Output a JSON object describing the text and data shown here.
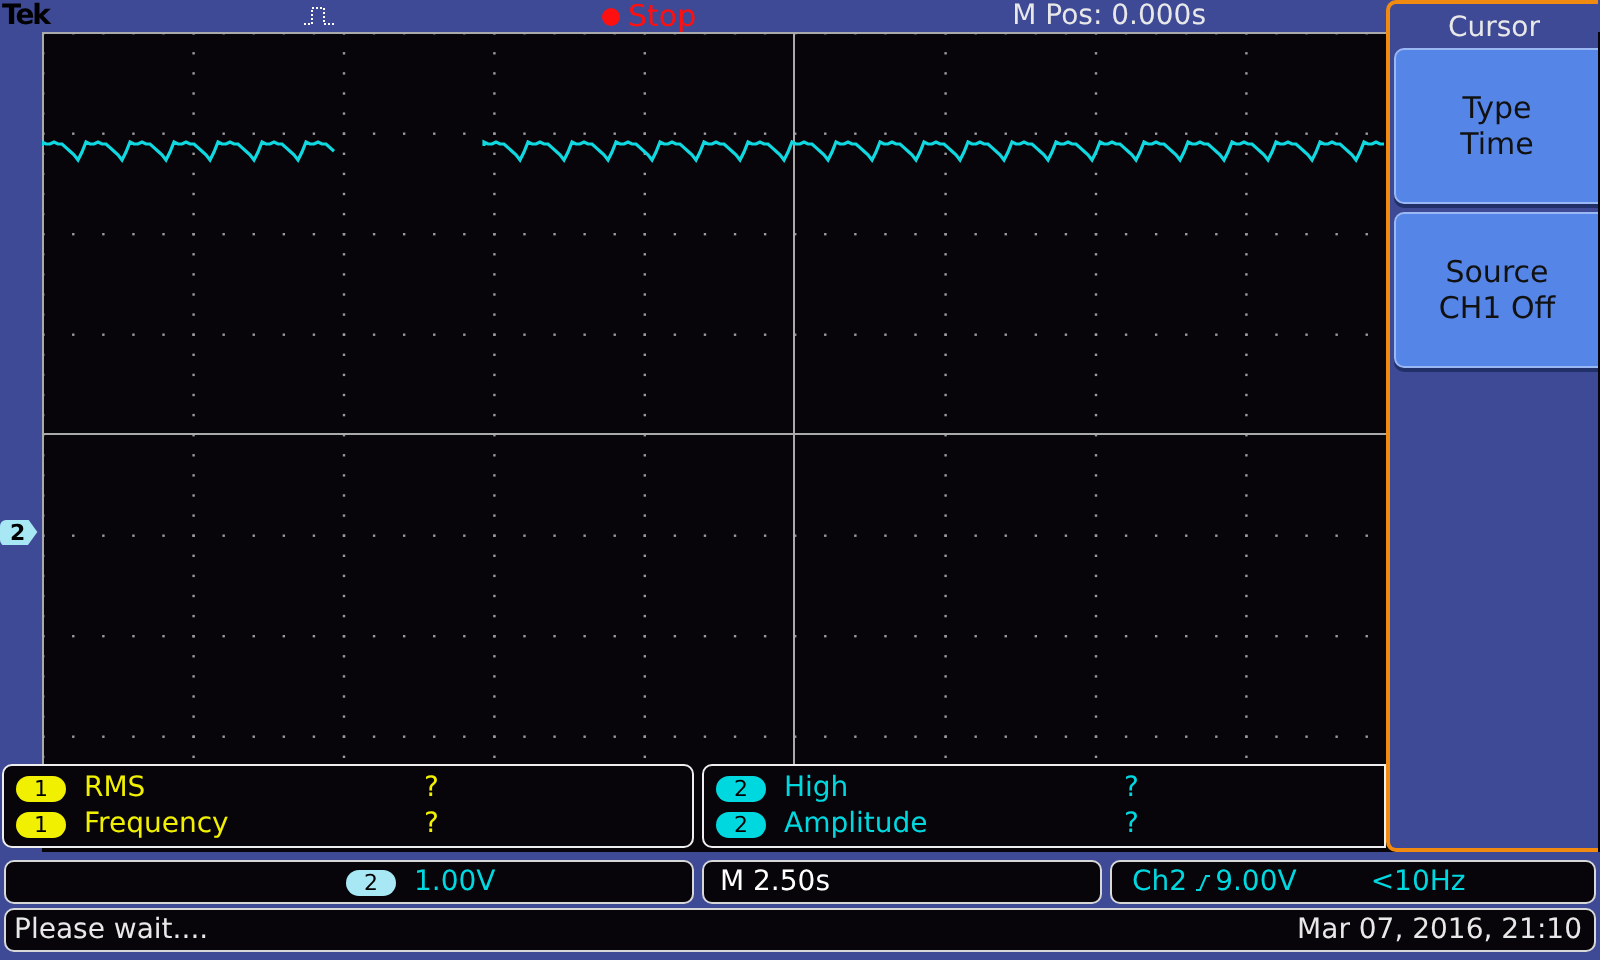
{
  "top_bar": {
    "brand": "Tek",
    "acquisition": {
      "label": "Stop",
      "running": false
    },
    "position": "M Pos: 0.000s"
  },
  "channel_marker": {
    "label": "2",
    "color": "#a8e8f4"
  },
  "side_menu": {
    "title": "Cursor",
    "buttons": [
      {
        "label": "Type",
        "value": "Time"
      },
      {
        "label": "Source",
        "value": "CH1 Off"
      }
    ]
  },
  "measurements": [
    [
      {
        "channel": "1",
        "name": "RMS",
        "value": "?",
        "color": "#f0f000"
      },
      {
        "channel": "1",
        "name": "Frequency",
        "value": "?",
        "color": "#f0f000"
      }
    ],
    [
      {
        "channel": "2",
        "name": "High",
        "value": "?",
        "color": "#00d8e0"
      },
      {
        "channel": "2",
        "name": "Amplitude",
        "value": "?",
        "color": "#00d8e0"
      }
    ]
  ],
  "scale": {
    "channel": "2",
    "value": "1.00V"
  },
  "timebase": "M 2.50s",
  "trigger": {
    "source": "Ch2",
    "level": "9.00V",
    "frequency": "<10Hz"
  },
  "status": {
    "message": "Please wait....",
    "datetime": "Mar 07, 2016, 21:10"
  }
}
